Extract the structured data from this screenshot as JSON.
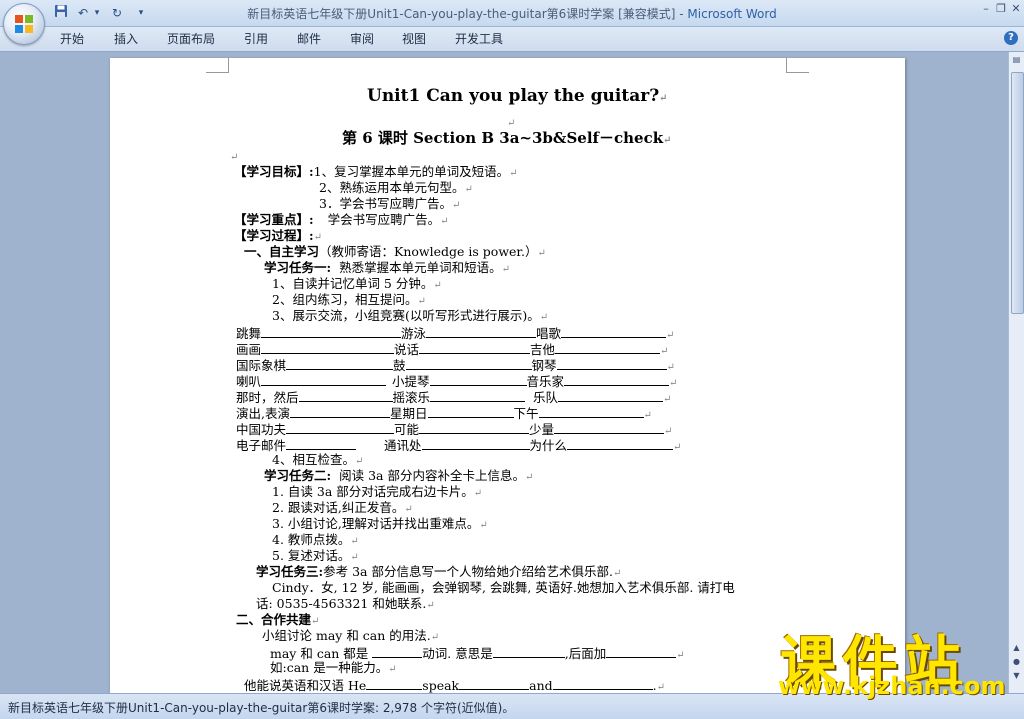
{
  "window": {
    "title": "新目标英语七年级下册Unit1-Can-you-play-the-guitar第6课时学案 [兼容模式]",
    "app": "Microsoft Word"
  },
  "ribbon": {
    "tabs": [
      "开始",
      "插入",
      "页面布局",
      "引用",
      "邮件",
      "审阅",
      "视图",
      "开发工具"
    ]
  },
  "status": {
    "text": "新目标英语七年级下册Unit1-Can-you-play-the-guitar第6课时学案: 2,978 个字符(近似值)。"
  },
  "document": {
    "title": "Unit1 Can you play the guitar?",
    "subtitle": "第 6 课时 Section B 3a~3b&Self－check",
    "goals_label": "【学习目标】:",
    "goal1": "1、复习掌握本单元的单词及短语。",
    "goal2": "2、熟练运用本单元句型。",
    "goal3": "3．学会书写应聘广告。",
    "focus_label": "【学习重点】:",
    "focus": "学会书写应聘广告。",
    "process_label": "【学习过程】:",
    "sec1_title": "一、自主学习",
    "sec1_note": "（教师寄语：Knowledge is power.）",
    "task1_label": "学习任务一:",
    "task1": "熟悉掌握本单元单词和短语。",
    "t1_step1": "1、自读并记忆单词 5 分钟。",
    "t1_step2": "2、组内练习，相互提问。",
    "t1_step3": "3、展示交流，小组竞赛(以听写形式进行展示)。",
    "vocab_rows": [
      [
        "跳舞",
        "游泳",
        "唱歌"
      ],
      [
        "画画",
        "说话",
        "吉他"
      ],
      [
        "国际象棋",
        "鼓",
        "钢琴"
      ],
      [
        "喇叭",
        "小提琴",
        "音乐家"
      ],
      [
        "那时，然后",
        "摇滚乐",
        "乐队"
      ],
      [
        "演出,表演",
        "星期日",
        "下午"
      ],
      [
        "中国功夫",
        "可能",
        "少量"
      ],
      [
        "电子邮件",
        "通讯处",
        "为什么"
      ]
    ],
    "t1_step4": "4、相互检查。",
    "task2_label": "学习任务二:",
    "task2": "阅读 3a 部分内容补全卡上信息。",
    "t2_steps": [
      "1. 自读 3a 部分对话完成右边卡片。",
      "2. 跟读对话,纠正发音。",
      "3. 小组讨论,理解对话并找出重难点。",
      "4. 教师点拨。",
      "5. 复述对话。"
    ],
    "task3_label": "学习任务三:",
    "task3": "参考 3a 部分信息写一个人物给她介绍给艺术俱乐部.",
    "task3_text1": "Cindy．女, 12 岁, 能画画，会弹钢琴, 会跳舞, 英语好.她想加入艺术俱乐部. 请打电",
    "task3_text2": "话: 0535-4563321 和她联系.",
    "sec2_title": "二、合作共建",
    "sec2_l1": "小组讨论 may 和 can 的用法.",
    "sec2_l2a": "may 和 can 都是",
    "sec2_l2b": "动词. 意思是",
    "sec2_l2c": ",后面加",
    "sec2_l3": "如:can 是一种能力。",
    "sec2_l4a": "他能说英语和汉语 He",
    "sec2_l4b": "speak",
    "sec2_l4c": "and",
    "sec2_l4d": "."
  },
  "watermark": {
    "cn": "课件站",
    "url": "www.kjzhan.com"
  }
}
